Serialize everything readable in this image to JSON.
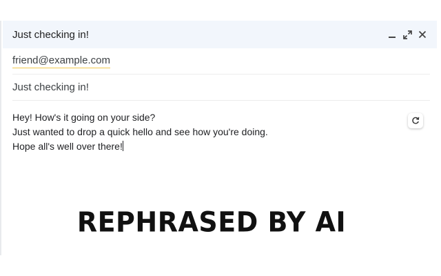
{
  "compose": {
    "title": "Just checking in!",
    "controls": {
      "minimize_icon": "minimize-icon",
      "expand_icon": "expand-icon",
      "close_icon": "close-icon"
    },
    "recipient": "friend@example.com",
    "subject": "Just checking in!",
    "body_lines": [
      "Hey! How's it going on your side?",
      "Just wanted to drop a quick hello and see how you're doing.",
      "Hope all's well over there!"
    ],
    "refresh_icon": "refresh-icon"
  },
  "banner": {
    "text": "REPHRASED BY AI"
  },
  "colors": {
    "header_bg": "#f2f6fc",
    "recipient_underline": "#f2c94c",
    "text": "#202124"
  }
}
